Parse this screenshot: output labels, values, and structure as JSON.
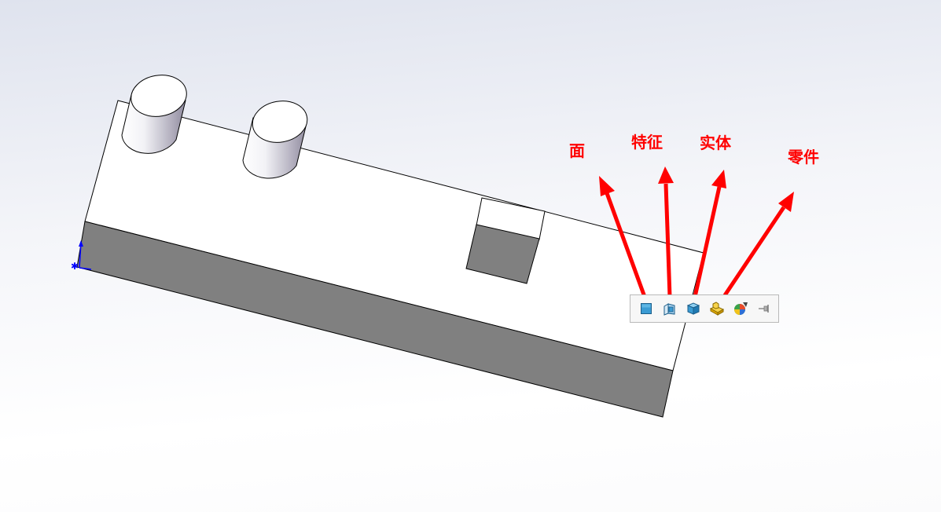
{
  "annotations": {
    "face": "面",
    "feature": "特征",
    "body": "实体",
    "part": "零件"
  },
  "toolbar": {
    "buttons": [
      {
        "name": "select-face-button",
        "icon": "face-icon"
      },
      {
        "name": "select-feature-button",
        "icon": "feature-icon"
      },
      {
        "name": "select-body-button",
        "icon": "body-icon"
      },
      {
        "name": "select-part-button",
        "icon": "part-icon"
      },
      {
        "name": "appearance-button",
        "icon": "appearance-icon"
      },
      {
        "name": "pin-button",
        "icon": "pin-icon"
      }
    ]
  },
  "colors": {
    "annotation": "#ff0000",
    "model_face_dark": "#808080",
    "model_face_light": "#ffffff",
    "triad_axis": "#0000ff"
  }
}
